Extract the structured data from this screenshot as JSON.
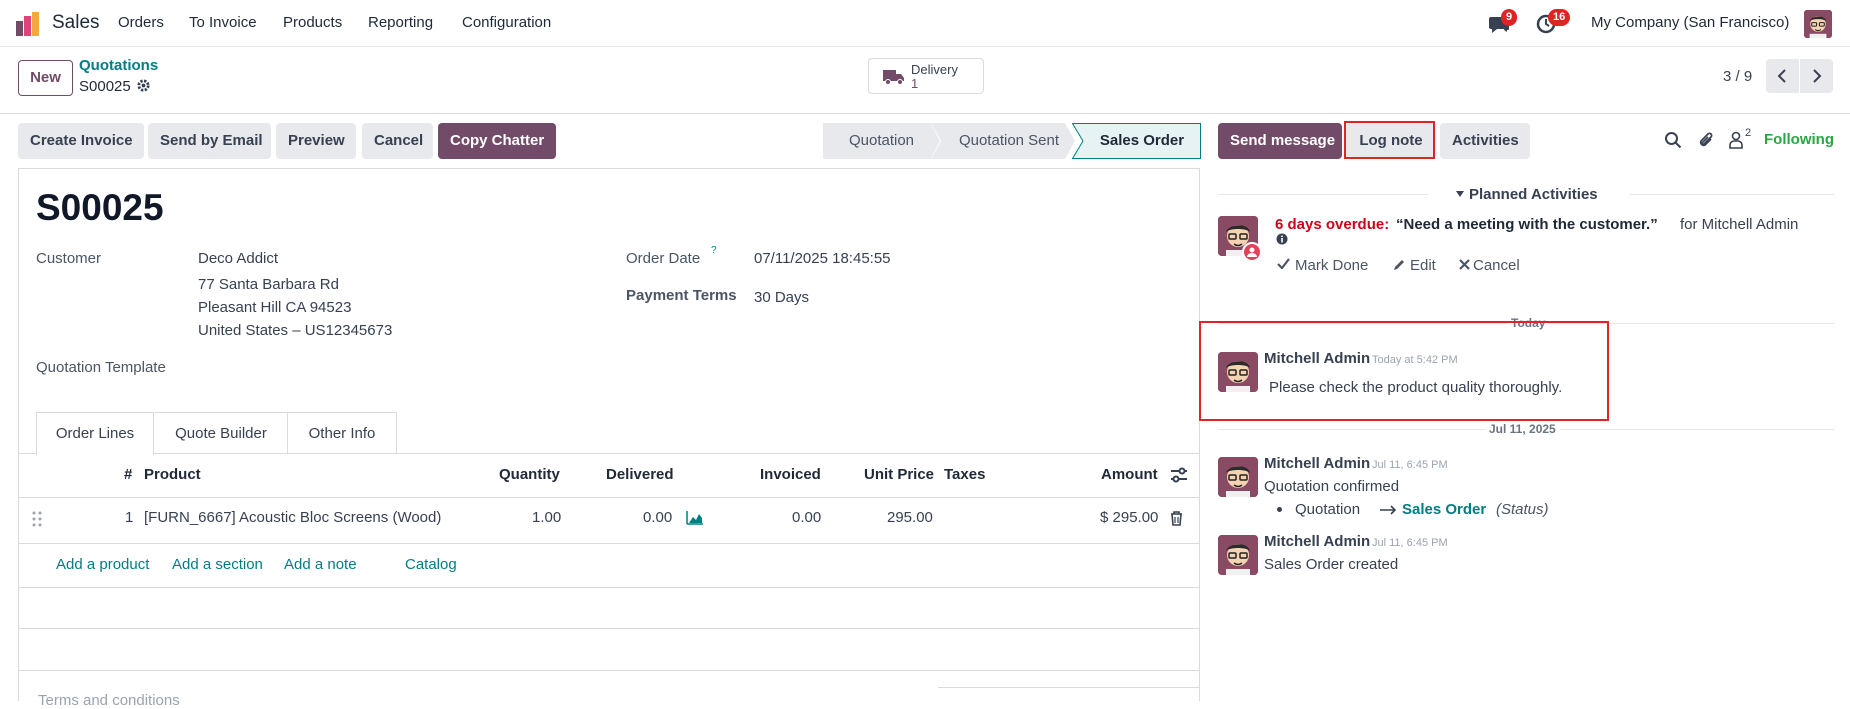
{
  "nav": {
    "app_name": "Sales",
    "menu": [
      "Orders",
      "To Invoice",
      "Products",
      "Reporting",
      "Configuration"
    ],
    "messages_badge": "9",
    "activities_badge": "16",
    "company": "My Company (San Francisco)"
  },
  "control": {
    "new_label": "New",
    "breadcrumb_parent": "Quotations",
    "record_name": "S00025",
    "delivery_label": "Delivery",
    "delivery_count": "1",
    "pager": "3 / 9"
  },
  "actions": {
    "create_invoice": "Create Invoice",
    "send_email": "Send by Email",
    "preview": "Preview",
    "cancel": "Cancel",
    "copy_chatter": "Copy Chatter"
  },
  "statusbar": {
    "stages": [
      "Quotation",
      "Quotation Sent",
      "Sales Order"
    ],
    "active": "Sales Order"
  },
  "form": {
    "title": "S00025",
    "customer_label": "Customer",
    "customer_name": "Deco Addict",
    "address_1": "77 Santa Barbara Rd",
    "address_2": "Pleasant Hill CA 94523",
    "address_3": "United States – US12345673",
    "quotation_template_label": "Quotation Template",
    "order_date_label": "Order Date",
    "order_date_help": "?",
    "order_date": "07/11/2025 18:45:55",
    "payment_terms_label": "Payment Terms",
    "payment_terms": "30 Days",
    "partial_text": "Terms and conditions"
  },
  "tabs": [
    "Order Lines",
    "Quote Builder",
    "Other Info"
  ],
  "order_lines": {
    "columns": [
      "#",
      "Product",
      "Quantity",
      "Delivered",
      "Invoiced",
      "Unit Price",
      "Taxes",
      "Amount"
    ],
    "rows": [
      {
        "num": "1",
        "product": "[FURN_6667] Acoustic Bloc Screens (Wood)",
        "quantity": "1.00",
        "delivered": "0.00",
        "invoiced": "0.00",
        "unit_price": "295.00",
        "taxes": "",
        "amount": "$ 295.00"
      }
    ],
    "add_product": "Add a product",
    "add_section": "Add a section",
    "add_note": "Add a note",
    "catalog": "Catalog"
  },
  "chatter": {
    "send_message": "Send message",
    "log_note": "Log note",
    "activities": "Activities",
    "followers_count": "2",
    "following": "Following",
    "planned_title": "Planned Activities",
    "planned": {
      "overdue": "6 days overdue:",
      "summary": "“Need a meeting with the customer.”",
      "assignee": "for Mitchell Admin",
      "mark_done": "Mark Done",
      "edit": "Edit",
      "cancel": "Cancel"
    },
    "today_label": "Today",
    "jul_label": "Jul 11, 2025",
    "messages": [
      {
        "author": "Mitchell Admin",
        "time": "Today at 5:42 PM",
        "body": "Please check the product quality thoroughly."
      },
      {
        "author": "Mitchell Admin",
        "time": "Jul 11, 6:45 PM",
        "body": "Quotation confirmed",
        "change_from": "Quotation",
        "change_to": "Sales Order",
        "change_field": "(Status)"
      },
      {
        "author": "Mitchell Admin",
        "time": "Jul 11, 6:45 PM",
        "body": "Sales Order created"
      }
    ]
  },
  "colors": {
    "primary": "#714b67",
    "teal": "#017e84",
    "overdue": "#d0021b",
    "highlight": "#e02424",
    "following": "#28a745"
  }
}
